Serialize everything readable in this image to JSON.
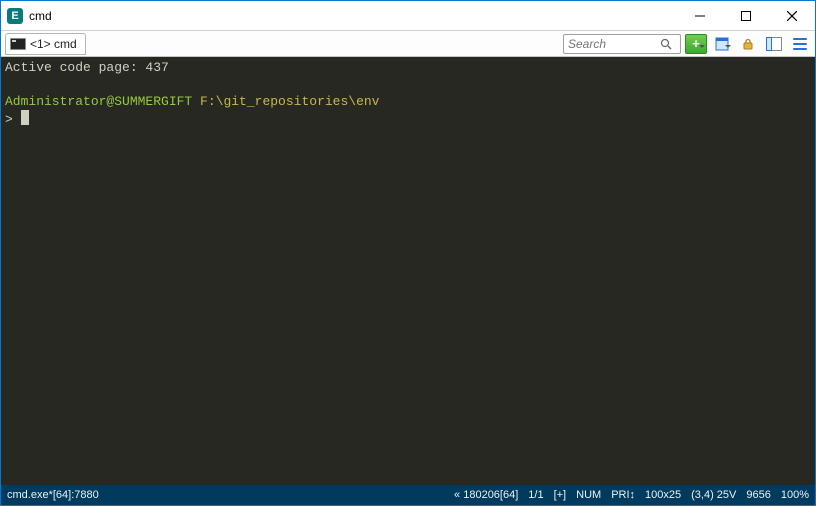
{
  "title": "cmd",
  "tab": {
    "label": "<1> cmd"
  },
  "search": {
    "placeholder": "Search"
  },
  "terminal": {
    "line1": "Active code page: 437",
    "prompt_user": "Administrator@SUMMERGIFT",
    "prompt_path": "F:\\git_repositories\\env",
    "prompt_symbol": ">"
  },
  "status": {
    "left": "cmd.exe*[64]:7880",
    "build": "« 180206[64]",
    "pos": "1/1",
    "plus": "[+]",
    "num": "NUM",
    "pri": "PRI↕",
    "size": "100x25",
    "cursor": "(3,4) 25V",
    "chars": "9656",
    "zoom": "100%"
  }
}
